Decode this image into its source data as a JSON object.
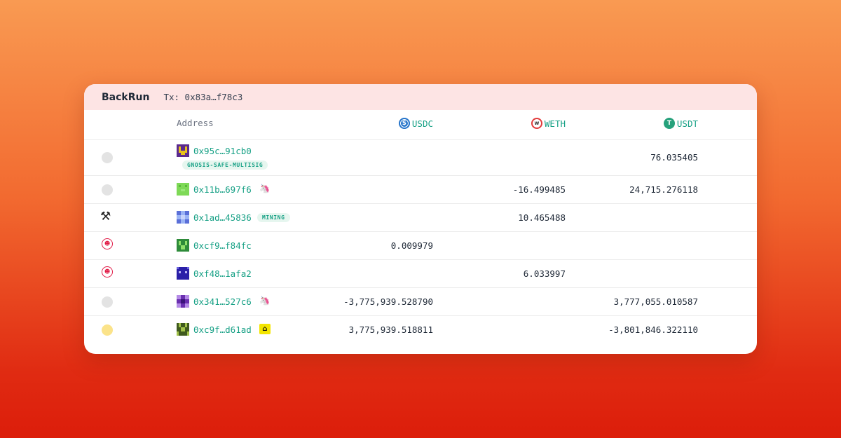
{
  "header": {
    "brand": "BackRun",
    "tx_label": "Tx: 0x83a…f78c3"
  },
  "columns": {
    "address": "Address",
    "tokens": [
      {
        "symbol": "USDC",
        "icon": "usdc-icon",
        "color": "#2775ca"
      },
      {
        "symbol": "WETH",
        "icon": "weth-icon",
        "color": "#e23b3b"
      },
      {
        "symbol": "USDT",
        "icon": "usdt-icon",
        "color": "#26a17b"
      }
    ]
  },
  "rows": [
    {
      "marker": "gray-dot",
      "address": "0x95c…91cb0",
      "badge": "GNOSIS-SAFE-MULTISIG",
      "usdc": "",
      "weth": "",
      "usdt": "76.035405"
    },
    {
      "marker": "gray-dot",
      "address": "0x11b…697f6",
      "tag_icon": "unicorn-icon",
      "usdc": "",
      "weth": "-16.499485",
      "usdt": "24,715.276118"
    },
    {
      "marker": "hammer-icon",
      "address": "0x1ad…45836",
      "badge": "MINING",
      "usdc": "",
      "weth": "10.465488",
      "usdt": ""
    },
    {
      "marker": "bot-icon",
      "address": "0xcf9…f84fc",
      "usdc": "0.009979",
      "weth": "",
      "usdt": ""
    },
    {
      "marker": "bot-icon",
      "address": "0xf48…1afa2",
      "usdc": "",
      "weth": "6.033997",
      "usdt": ""
    },
    {
      "marker": "gray-dot",
      "address": "0x341…527c6",
      "tag_icon": "unicorn-icon",
      "usdc": "-3,775,939.528790",
      "weth": "",
      "usdt": "3,777,055.010587"
    },
    {
      "marker": "yellow-dot",
      "address": "0xc9f…d61ad",
      "tag_icon": "curve-logo-icon",
      "usdc": "3,775,939.518811",
      "weth": "",
      "usdt": "-3,801,846.322110"
    }
  ],
  "colors": {
    "accent": "#16a085",
    "header_bg": "#fde4e4",
    "negative_text": "#1f2937"
  }
}
